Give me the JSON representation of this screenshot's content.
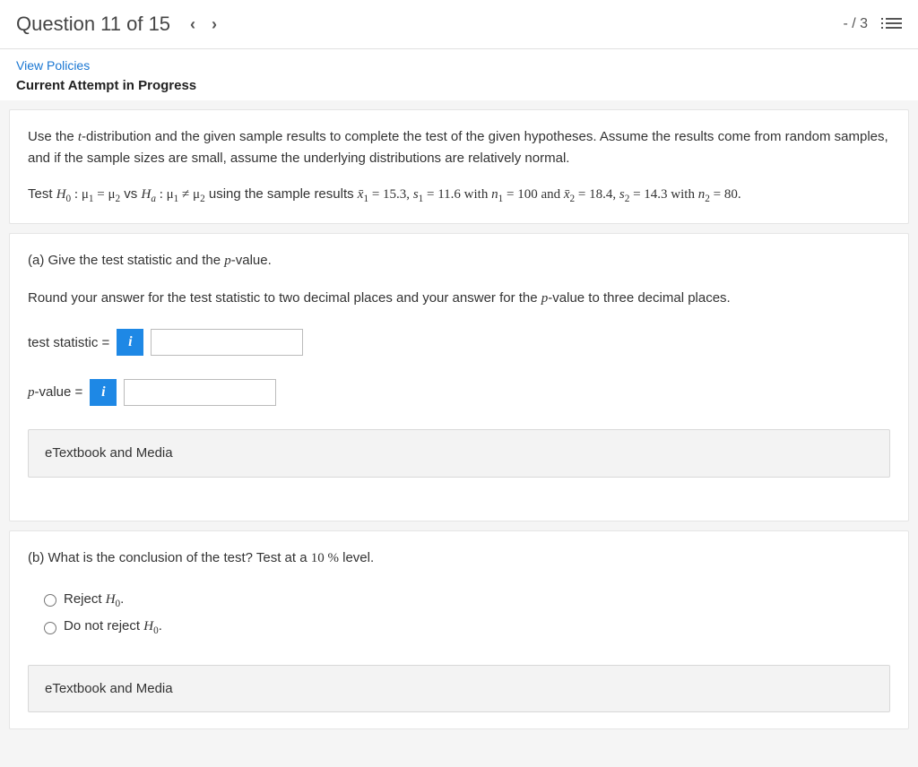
{
  "header": {
    "question_label": "Question 11 of 15",
    "score": "- / 3"
  },
  "subheader": {
    "view_policies": "View Policies",
    "attempt_status": "Current Attempt in Progress"
  },
  "instructions": {
    "para1_a": "Use the ",
    "para1_t": "t",
    "para1_b": "-distribution and the given sample results to complete the test of the given hypotheses. Assume the results come from random samples, and if the sample sizes are small, assume the underlying distributions are relatively normal.",
    "test_prefix": "Test ",
    "h0": "H",
    "zero": "0",
    "colon_mu1": " : μ",
    "one": "1",
    "eq_mu2": " = μ",
    "two": "2",
    "vs": " vs ",
    "ha": "H",
    "a": "a",
    "colon_mu1b": " : μ",
    "neq_mu2": " ≠ μ",
    "using": " using the sample results ",
    "xbar1": "x̄",
    "eq153": " = 15.3, ",
    "s1": "s",
    "eq116": " = 11.6 with ",
    "n1": "n",
    "eq100": " = 100 and ",
    "xbar2": "x̄",
    "eq184": " = 18.4, ",
    "s2": "s",
    "eq143": " = 14.3 with ",
    "n2line": "n",
    "eq80": " = 80."
  },
  "partA": {
    "label_a": "(a) Give the test statistic and the ",
    "label_p": "p",
    "label_b": "-value.",
    "round_a": "Round your answer for the test statistic to two decimal places and your answer for the ",
    "round_p": "p",
    "round_b": "-value to three decimal places.",
    "ts_label": "test statistic = ",
    "pv_label_p": "p",
    "pv_label_rest": "-value = ",
    "info_icon": "i",
    "etextbook": "eTextbook and Media"
  },
  "partB": {
    "label_a": "(b) What is the conclusion of the test? Test at a ",
    "level": "10 %",
    "label_b": " level.",
    "opt1_a": "Reject ",
    "opt1_h": "H",
    "opt1_sub": "0",
    "opt1_dot": ".",
    "opt2_a": "Do not reject ",
    "opt2_h": "H",
    "opt2_sub": "0",
    "opt2_dot": ".",
    "etextbook": "eTextbook and Media"
  }
}
